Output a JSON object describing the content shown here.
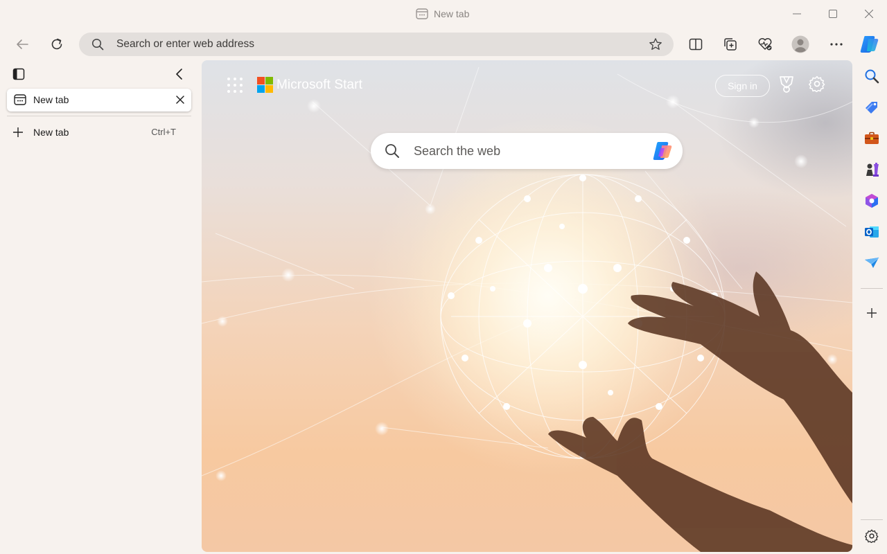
{
  "window": {
    "title": "New tab"
  },
  "toolbar": {
    "address_placeholder": "Search or enter web address",
    "icons": [
      "back-icon",
      "refresh-icon",
      "search-icon",
      "favorite-star-icon",
      "split-screen-icon",
      "collections-icon",
      "browser-essentials-icon",
      "profile-avatar-icon",
      "more-menu-icon",
      "copilot-icon"
    ]
  },
  "vertical_tabs": {
    "tabs": [
      {
        "label": "New tab",
        "active": true
      }
    ],
    "new_tab": {
      "label": "New tab",
      "shortcut": "Ctrl+T"
    }
  },
  "newtab_page": {
    "brand": "Microsoft Start",
    "sign_in": "Sign in",
    "search_placeholder": "Search the web"
  },
  "sidebar": {
    "items": [
      "search-icon",
      "shopping-tag-icon",
      "tools-briefcase-icon",
      "games-icon",
      "microsoft-365-icon",
      "outlook-icon",
      "drop-send-icon",
      "add-icon",
      "settings-gear-icon"
    ]
  },
  "colors": {
    "chrome_bg": "#f7f2ee",
    "address_bar": "#e3dfdc",
    "accent_blue": "#1a73e8"
  }
}
